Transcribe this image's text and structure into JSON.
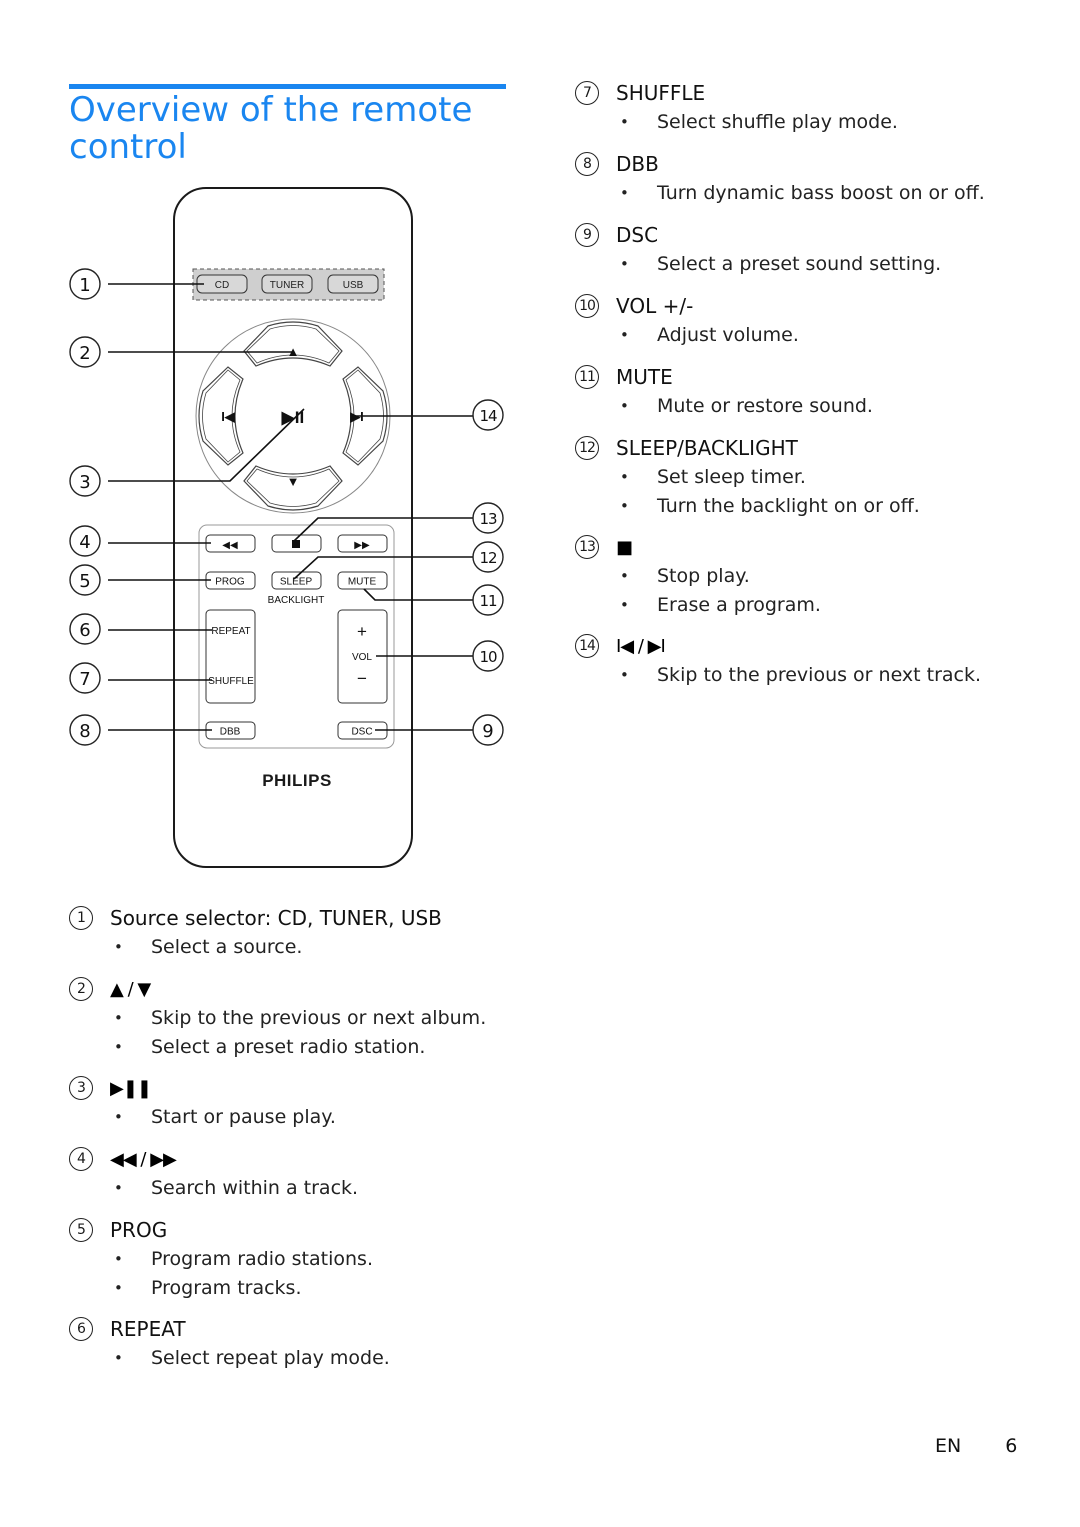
{
  "header": {
    "title_line1": "Overview of the remote",
    "title_line2": "control",
    "accent_color": "#1a86f0"
  },
  "remote": {
    "brand": "PHILIPS",
    "source_buttons": [
      "CD",
      "TUNER",
      "USB"
    ],
    "nav": {
      "up_icon": "▲",
      "down_icon": "▼",
      "prev_icon": "◀",
      "next_icon": "▶",
      "play_pause_icon": "▶II"
    },
    "transport": {
      "rewind_icon": "◀◀",
      "stop_icon": "■",
      "forward_icon": "▶▶"
    },
    "buttons": {
      "prog": "PROG",
      "sleep": "SLEEP",
      "backlight": "BACKLIGHT",
      "mute": "MUTE",
      "repeat": "REPEAT",
      "shuffle": "SHUFFLE",
      "vol_plus": "+",
      "vol": "VOL",
      "vol_minus": "−",
      "dbb": "DBB",
      "dsc": "DSC"
    },
    "callouts_left": [
      "1",
      "2",
      "3",
      "4",
      "5",
      "6",
      "7",
      "8"
    ],
    "callouts_right": [
      "14",
      "13",
      "12",
      "11",
      "10",
      "9"
    ]
  },
  "items": [
    {
      "num": "1",
      "label": "Source selector: CD, TUNER, USB",
      "bullets": [
        "Select a source."
      ]
    },
    {
      "num": "2",
      "label": "▲ / ▼",
      "icon": "up-down-arrows",
      "bullets": [
        "Skip to the previous or next album.",
        "Select a preset radio station."
      ]
    },
    {
      "num": "3",
      "label": "▶❚❚",
      "icon": "play-pause",
      "bullets": [
        "Start or pause play."
      ]
    },
    {
      "num": "4",
      "label": "◀◀ / ▶▶",
      "icon": "rewind-forward",
      "bullets": [
        "Search within a track."
      ]
    },
    {
      "num": "5",
      "label": "PROG",
      "bullets": [
        "Program radio stations.",
        "Program tracks."
      ]
    },
    {
      "num": "6",
      "label": "REPEAT",
      "bullets": [
        "Select repeat play mode."
      ]
    },
    {
      "num": "7",
      "label": "SHUFFLE",
      "bullets": [
        "Select shuffle play mode."
      ]
    },
    {
      "num": "8",
      "label": "DBB",
      "bullets": [
        "Turn dynamic bass boost on or off."
      ]
    },
    {
      "num": "9",
      "label": "DSC",
      "bullets": [
        "Select a preset sound setting."
      ]
    },
    {
      "num": "10",
      "label": "VOL +/-",
      "bullets": [
        "Adjust volume."
      ]
    },
    {
      "num": "11",
      "label": "MUTE",
      "bullets": [
        "Mute or restore sound."
      ]
    },
    {
      "num": "12",
      "label": "SLEEP/BACKLIGHT",
      "bullets": [
        "Set sleep timer.",
        "Turn the backlight on or off."
      ]
    },
    {
      "num": "13",
      "label": "■",
      "icon": "stop",
      "bullets": [
        "Stop play.",
        "Erase a program."
      ]
    },
    {
      "num": "14",
      "label": "I◀ / ▶I",
      "icon": "prev-next-track",
      "bullets": [
        "Skip to the previous or next track."
      ]
    }
  ],
  "footer": {
    "language": "EN",
    "page_number": "6"
  }
}
